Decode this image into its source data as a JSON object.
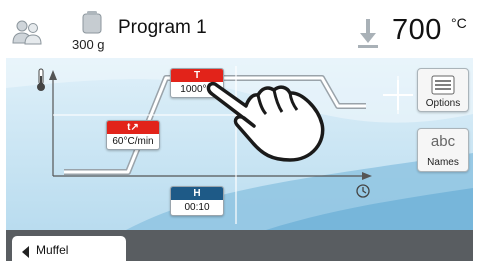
{
  "header": {
    "user_icon": "user-group-icon",
    "weight_icon": "weight-icon",
    "weight_label": "300 g",
    "program_title": "Program 1",
    "temp_icon": "temperature-down-icon",
    "temperature_value": "700",
    "temperature_unit": "°C"
  },
  "graph": {
    "thermometer_icon": "thermometer-icon",
    "clock_icon": "clock-icon",
    "steps": {
      "rate": {
        "label": "t↗",
        "value": "60°C/min"
      },
      "temperature": {
        "label": "T",
        "value": "1000°C"
      },
      "hold": {
        "label": "H",
        "value": "00:10"
      }
    }
  },
  "side_buttons": {
    "add_icon": "plus-icon",
    "options_label": "Options",
    "names_icon_text": "abc",
    "names_label": "Names"
  },
  "footer": {
    "back_tab_label": "Muffel"
  },
  "colors": {
    "accent_red": "#e2231a",
    "accent_blue": "#1e5a87",
    "footer_bg": "#595d61",
    "graph_bg": "#cfe6f3"
  }
}
